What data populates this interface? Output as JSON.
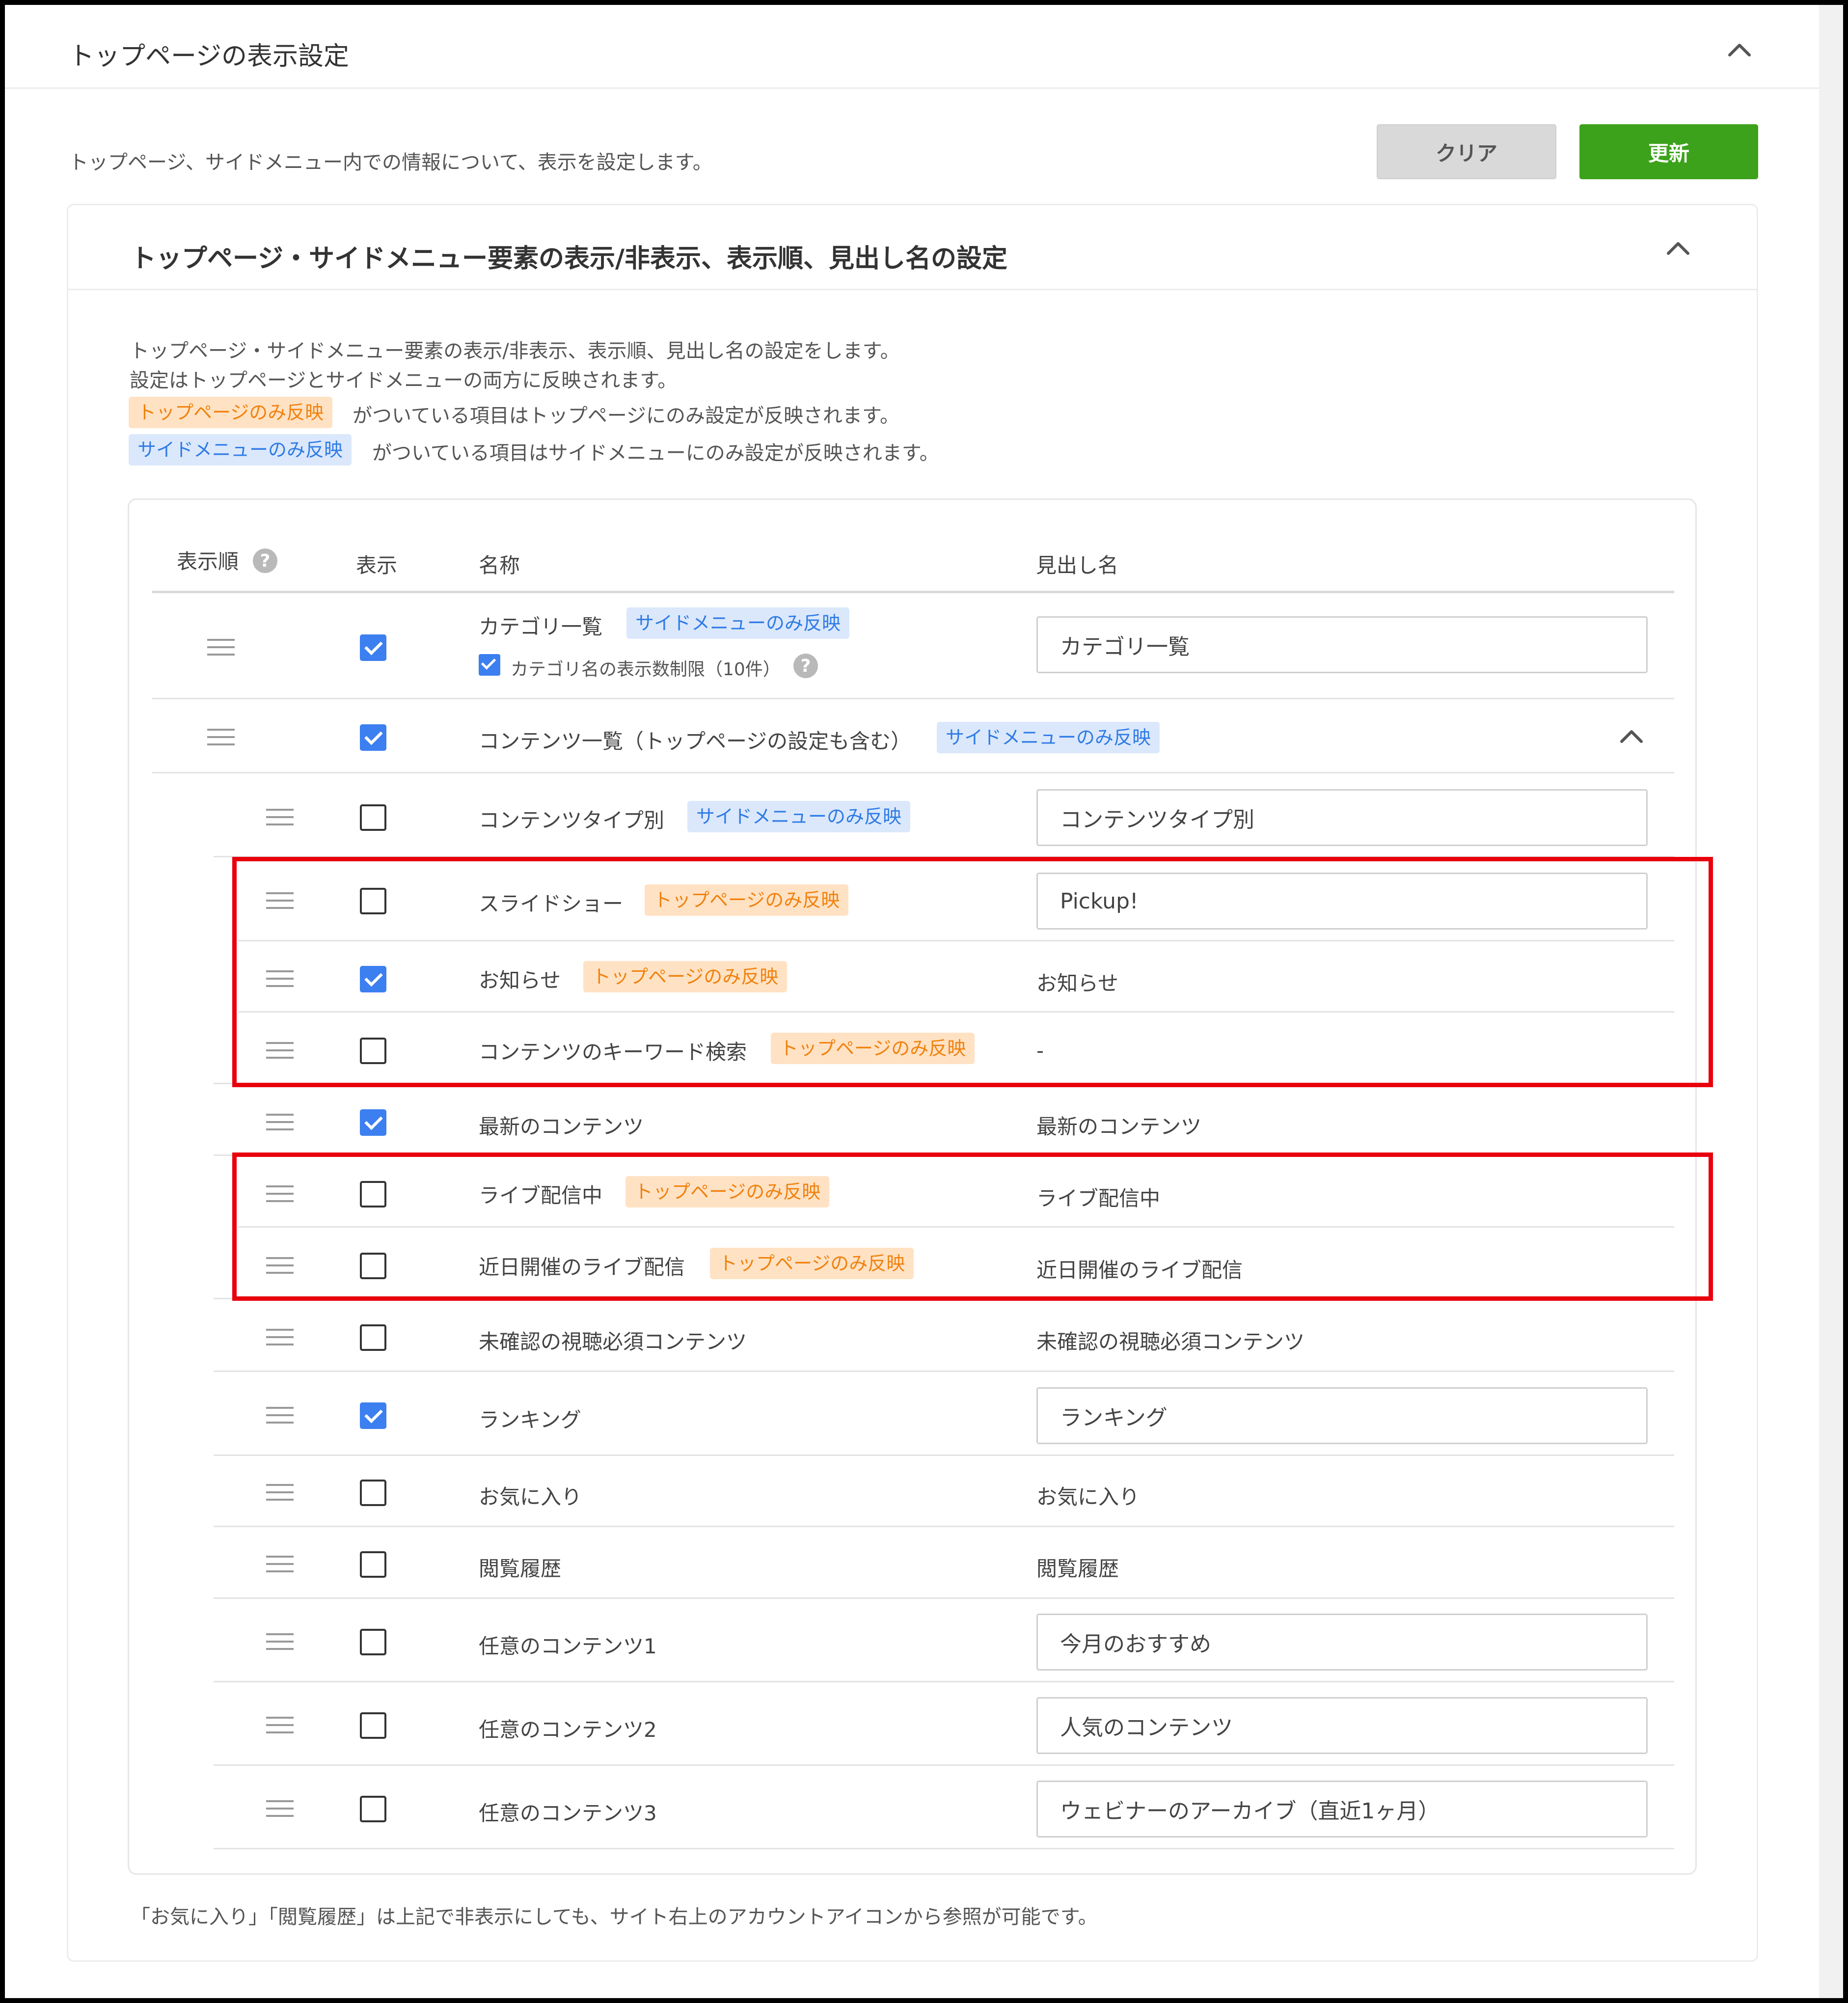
{
  "page": {
    "title": "トップページの表示設定",
    "description": "トップページ、サイドメニュー内での情報について、表示を設定します。",
    "buttons": {
      "clear": "クリア",
      "update": "更新"
    }
  },
  "section": {
    "title": "トップページ・サイドメニュー要素の表示/非表示、表示順、見出し名の設定",
    "intro_lines": [
      "トップページ・サイドメニュー要素の表示/非表示、表示順、見出し名の設定をします。",
      "設定はトップページとサイドメニューの両方に反映されます。"
    ],
    "legend_top_tag": "トップページのみ反映",
    "legend_top_text": "がついている項目はトップページにのみ設定が反映されます。",
    "legend_side_tag": "サイドメニューのみ反映",
    "legend_side_text": "がついている項目はサイドメニューにのみ設定が反映されます。"
  },
  "table": {
    "headers": {
      "order": "表示順",
      "order_help": "?",
      "display": "表示",
      "name": "名称",
      "heading": "見出し名"
    },
    "rows": [
      {
        "name": "カテゴリ一覧",
        "tag": "サイドメニューのみ反映",
        "checked": true,
        "heading": "カテゴリ一覧",
        "sub_label": "カテゴリ名の表示数制限（10件）",
        "sub_help": "?"
      },
      {
        "name": "コンテンツ一覧（トップページの設定も含む）",
        "tag": "サイドメニューのみ反映",
        "checked": true
      },
      {
        "name": "コンテンツタイプ別",
        "tag": "サイドメニューのみ反映",
        "checked": false,
        "heading": "コンテンツタイプ別"
      },
      {
        "name": "スライドショー",
        "tag": "トップページのみ反映",
        "checked": false,
        "heading": "Pickup!"
      },
      {
        "name": "お知らせ",
        "tag": "トップページのみ反映",
        "checked": true,
        "heading": "お知らせ"
      },
      {
        "name": "コンテンツのキーワード検索",
        "tag": "トップページのみ反映",
        "checked": false,
        "heading": "-"
      },
      {
        "name": "最新のコンテンツ",
        "checked": true,
        "heading": "最新のコンテンツ"
      },
      {
        "name": "ライブ配信中",
        "tag": "トップページのみ反映",
        "checked": false,
        "heading": "ライブ配信中"
      },
      {
        "name": "近日開催のライブ配信",
        "tag": "トップページのみ反映",
        "checked": false,
        "heading": "近日開催のライブ配信"
      },
      {
        "name": "未確認の視聴必須コンテンツ",
        "checked": false,
        "heading": "未確認の視聴必須コンテンツ"
      },
      {
        "name": "ランキング",
        "checked": true,
        "heading": "ランキング"
      },
      {
        "name": "お気に入り",
        "checked": false,
        "heading": "お気に入り"
      },
      {
        "name": "閲覧履歴",
        "checked": false,
        "heading": "閲覧履歴"
      },
      {
        "name": "任意のコンテンツ1",
        "checked": false,
        "heading": "今月のおすすめ"
      },
      {
        "name": "任意のコンテンツ2",
        "checked": false,
        "heading": "人気のコンテンツ"
      },
      {
        "name": "任意のコンテンツ3",
        "checked": false,
        "heading": "ウェビナーのアーカイブ（直近1ヶ月）"
      }
    ]
  },
  "footer_note": "「お気に入り」「閲覧履歴」は上記で非表示にしても、サイト右上のアカウントアイコンから参照が可能です。",
  "colors": {
    "update_button": "#3ca21b",
    "checkbox_checked": "#3c7ff0",
    "tag_top_bg": "#ffe2c4",
    "tag_top_text": "#f0820f",
    "tag_side_bg": "#dbe8fb",
    "tag_side_text": "#2f7be6",
    "highlight_box": "#e8000c"
  }
}
